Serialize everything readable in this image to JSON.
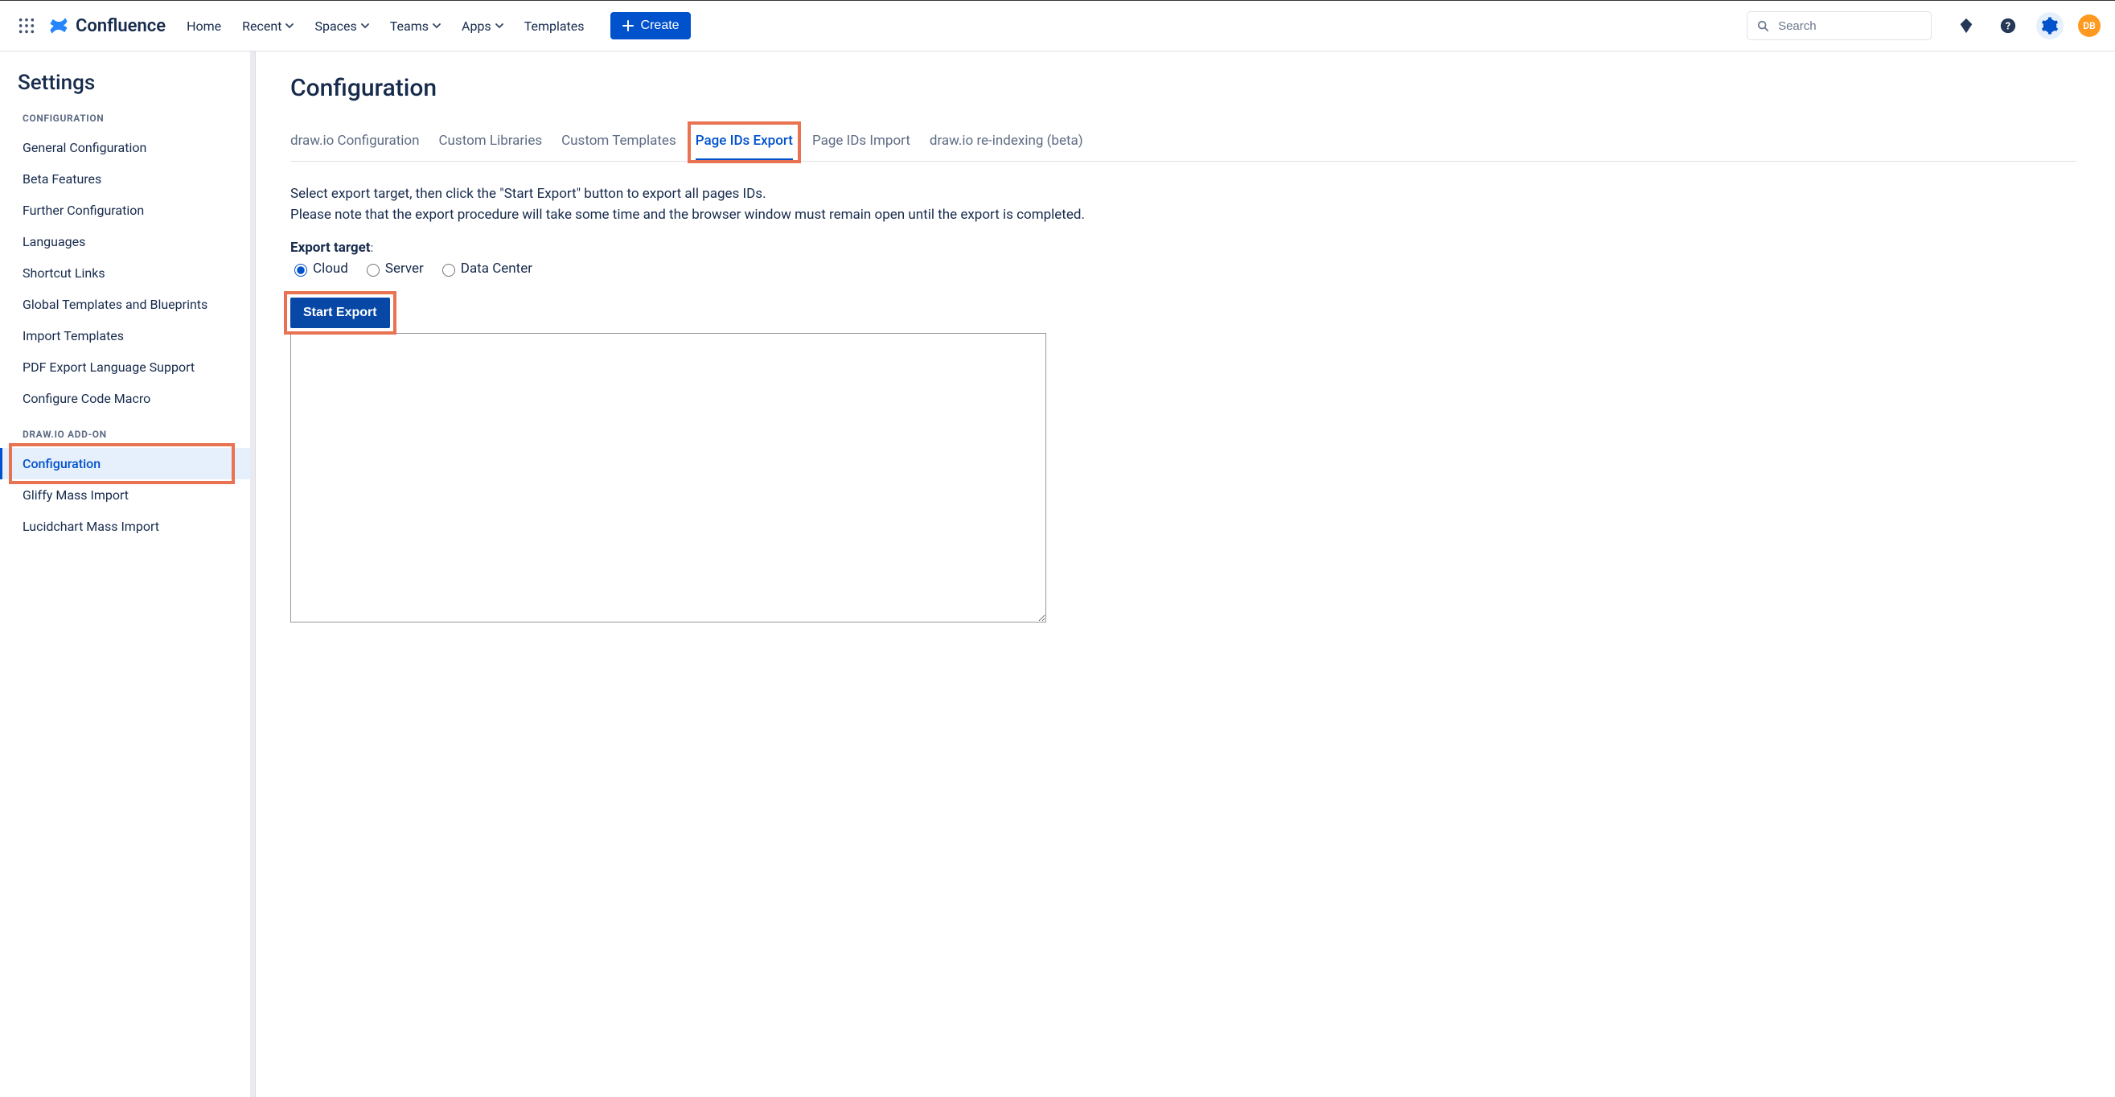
{
  "header": {
    "product": "Confluence",
    "nav": [
      {
        "label": "Home",
        "dropdown": false
      },
      {
        "label": "Recent",
        "dropdown": true
      },
      {
        "label": "Spaces",
        "dropdown": true
      },
      {
        "label": "Teams",
        "dropdown": true
      },
      {
        "label": "Apps",
        "dropdown": true
      },
      {
        "label": "Templates",
        "dropdown": false
      }
    ],
    "create_label": "Create",
    "search_placeholder": "Search",
    "avatar_initials": "DB"
  },
  "sidebar": {
    "title": "Settings",
    "sections": [
      {
        "heading": "CONFIGURATION",
        "items": [
          {
            "label": "General Configuration"
          },
          {
            "label": "Beta Features"
          },
          {
            "label": "Further Configuration"
          },
          {
            "label": "Languages"
          },
          {
            "label": "Shortcut Links"
          },
          {
            "label": "Global Templates and Blueprints"
          },
          {
            "label": "Import Templates"
          },
          {
            "label": "PDF Export Language Support"
          },
          {
            "label": "Configure Code Macro"
          }
        ]
      },
      {
        "heading": "DRAW.IO ADD-ON",
        "items": [
          {
            "label": "Configuration",
            "selected": true,
            "highlighted": true
          },
          {
            "label": "Gliffy Mass Import"
          },
          {
            "label": "Lucidchart Mass Import"
          }
        ]
      }
    ]
  },
  "main": {
    "title": "Configuration",
    "tabs": [
      {
        "label": "draw.io Configuration"
      },
      {
        "label": "Custom Libraries"
      },
      {
        "label": "Custom Templates"
      },
      {
        "label": "Page IDs Export",
        "active": true,
        "highlighted": true
      },
      {
        "label": "Page IDs Import"
      },
      {
        "label": "draw.io re-indexing (beta)"
      }
    ],
    "description_line1": "Select export target, then click the \"Start Export\" button to export all pages IDs.",
    "description_line2": "Please note that the export procedure will take some time and the browser window must remain open until the export is completed.",
    "export_target_label": "Export target",
    "radios": [
      {
        "label": "Cloud",
        "checked": true
      },
      {
        "label": "Server",
        "checked": false
      },
      {
        "label": "Data Center",
        "checked": false
      }
    ],
    "start_button": "Start Export"
  }
}
